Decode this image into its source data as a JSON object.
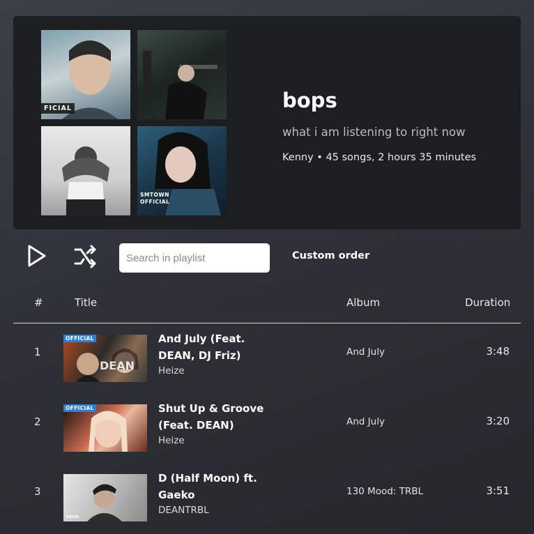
{
  "playlist": {
    "title": "bops",
    "description": "what i am listening to right now",
    "meta": "Kenny • 45 songs, 2 hours 35 minutes",
    "covers": [
      {
        "tag": "FICIAL"
      },
      {
        "tag": ""
      },
      {
        "tag": ""
      },
      {
        "tag": "SMTOWN\nOFFICIAL"
      }
    ]
  },
  "controls": {
    "play_icon": "play-icon",
    "shuffle_icon": "shuffle-icon",
    "search_placeholder": "Search in playlist",
    "order_label": "Custom order"
  },
  "table": {
    "headers": {
      "num": "#",
      "title": "Title",
      "album": "Album",
      "duration": "Duration"
    },
    "rows": [
      {
        "num": "1",
        "title": "And July (Feat. DEAN, DJ Friz)",
        "artist": "Heize",
        "album": "And July",
        "duration": "3:48",
        "badge": "OFFICIAL"
      },
      {
        "num": "2",
        "title": "Shut Up & Groove (Feat. DEAN)",
        "artist": "Heize",
        "album": "And July",
        "duration": "3:20",
        "badge": "OFFICIAL"
      },
      {
        "num": "3",
        "title": "D (Half Moon) ft. Gaeko",
        "artist": "DEANTRBL",
        "album": "130 Mood: TRBL",
        "duration": "3:51",
        "badge": "vevo"
      }
    ]
  },
  "colors": {
    "card_bg": "#1c1e22",
    "badge_blue": "#2d7fd3"
  }
}
